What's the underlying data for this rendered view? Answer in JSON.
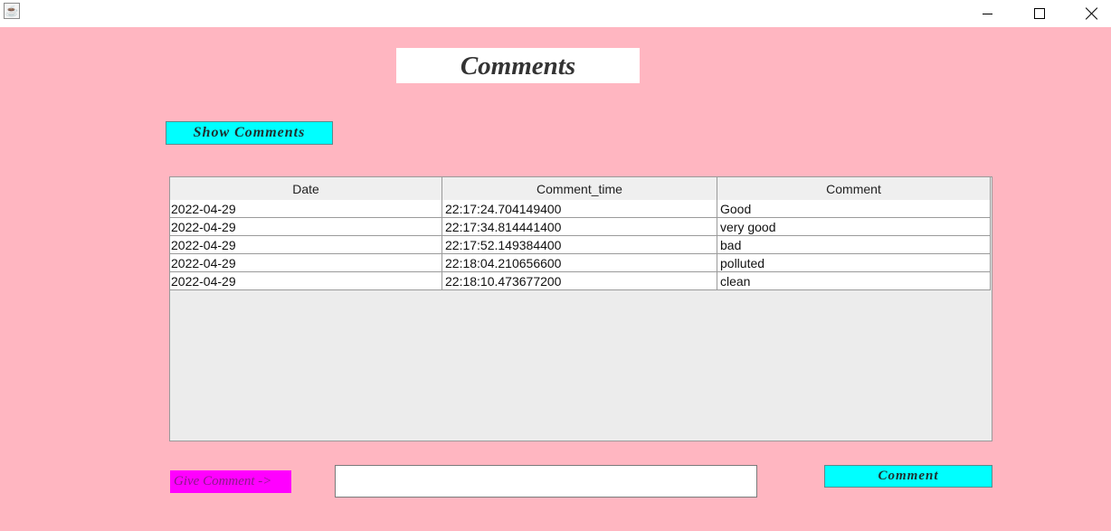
{
  "window": {
    "app_icon": "java-cup-icon",
    "controls": {
      "minimize": "minimize-icon",
      "maximize": "maximize-icon",
      "close": "close-icon"
    }
  },
  "heading": "Comments",
  "show_button": "Show Comments",
  "table": {
    "columns": [
      "Date",
      "Comment_time",
      "Comment"
    ],
    "rows": [
      [
        "2022-04-29",
        "22:17:24.704149400",
        "Good"
      ],
      [
        "2022-04-29",
        "22:17:34.814441400",
        "very good"
      ],
      [
        "2022-04-29",
        "22:17:52.149384400",
        "bad"
      ],
      [
        "2022-04-29",
        "22:18:04.210656600",
        "polluted"
      ],
      [
        "2022-04-29",
        "22:18:10.473677200",
        "clean"
      ]
    ]
  },
  "give_comment_label": "Give Comment ->",
  "comment_input": {
    "value": "",
    "placeholder": ""
  },
  "comment_button": "Comment",
  "colors": {
    "background": "#ffb6c1",
    "button": "#00ffff",
    "label": "#ff00ff"
  }
}
